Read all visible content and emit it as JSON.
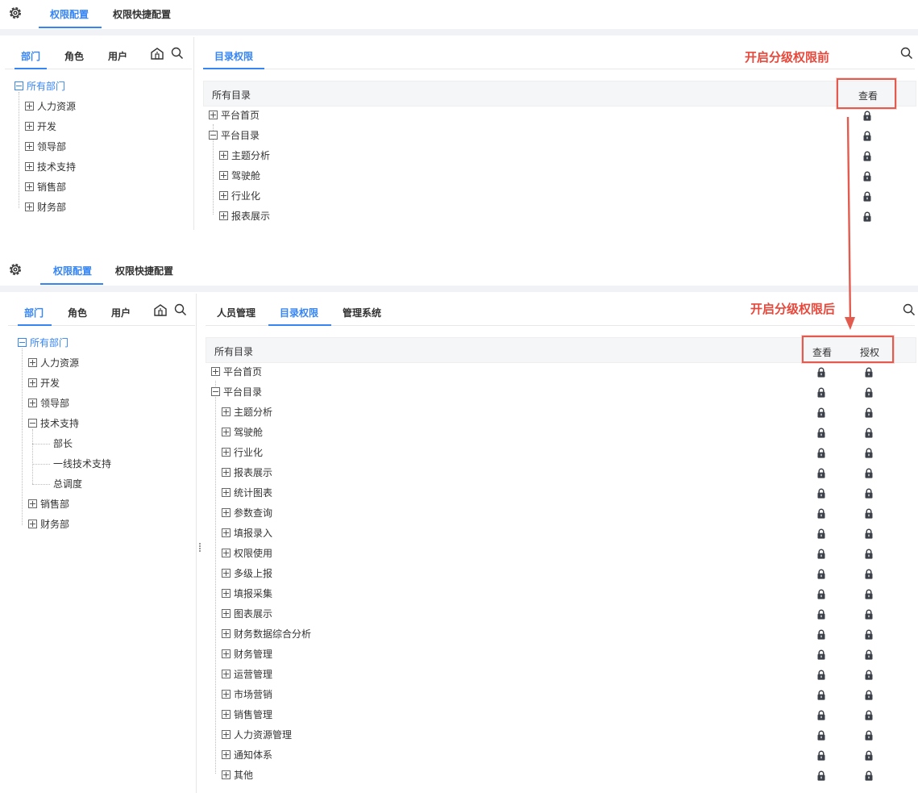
{
  "before": {
    "top_tabs": [
      "权限配置",
      "权限快捷配置"
    ],
    "left_tabs": [
      "部门",
      "角色",
      "用户"
    ],
    "right_tabs": [
      "目录权限"
    ],
    "annotation": "开启分级权限前",
    "header": {
      "label": "所有目录",
      "columns": [
        "查看"
      ]
    },
    "dept_tree": {
      "root": "所有部门",
      "children": [
        "人力资源",
        "开发",
        "领导部",
        "技术支持",
        "销售部",
        "财务部"
      ]
    },
    "catalog": {
      "top": [
        "平台首页",
        "平台目录"
      ],
      "children": [
        "主题分析",
        "驾驶舱",
        "行业化",
        "报表展示"
      ]
    }
  },
  "after": {
    "top_tabs": [
      "权限配置",
      "权限快捷配置"
    ],
    "left_tabs": [
      "部门",
      "角色",
      "用户"
    ],
    "right_tabs": [
      "人员管理",
      "目录权限",
      "管理系统"
    ],
    "annotation": "开启分级权限后",
    "header": {
      "label": "所有目录",
      "columns": [
        "查看",
        "授权"
      ]
    },
    "dept_tree": {
      "root": "所有部门",
      "children": [
        "人力资源",
        "开发",
        "领导部",
        "技术支持",
        "销售部",
        "财务部"
      ],
      "tech_children": [
        "部长",
        "一线技术支持",
        "总调度"
      ]
    },
    "catalog": {
      "top": [
        "平台首页",
        "平台目录"
      ],
      "children": [
        "主题分析",
        "驾驶舱",
        "行业化",
        "报表展示",
        "统计图表",
        "参数查询",
        "填报录入",
        "权限使用",
        "多级上报",
        "填报采集",
        "图表展示",
        "财务数据综合分析",
        "财务管理",
        "运营管理",
        "市场营销",
        "销售管理",
        "人力资源管理",
        "通知体系",
        "其他"
      ]
    }
  },
  "colors": {
    "accent": "#3685f2",
    "annotation": "#e8483b",
    "lock": "#3c4048"
  },
  "icons": [
    "gear-icon",
    "building-icon",
    "search-icon",
    "lock-icon",
    "arrow-icon"
  ]
}
